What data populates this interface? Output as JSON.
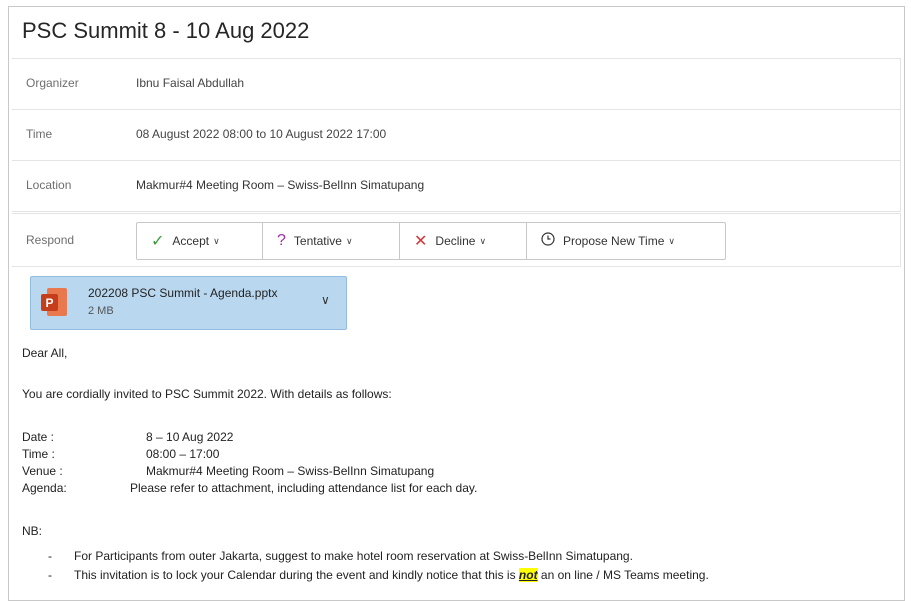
{
  "meeting": {
    "title": "PSC Summit 8 - 10 Aug 2022",
    "organizer_label": "Organizer",
    "organizer": "Ibnu Faisal Abdullah",
    "time_label": "Time",
    "time": "08 August 2022 08:00 to 10 August 2022 17:00",
    "location_label": "Location",
    "location": "Makmur#4 Meeting Room – Swiss-BelInn Simatupang",
    "respond_label": "Respond"
  },
  "respond": {
    "accept": "Accept",
    "tentative": "Tentative",
    "decline": "Decline",
    "propose": "Propose New Time"
  },
  "attachment": {
    "name": "202208 PSC Summit - Agenda.pptx",
    "size": "2 MB"
  },
  "body": {
    "greeting": "Dear All,",
    "intro": "You are cordially invited to PSC Summit 2022. With details as follows:",
    "date_label": "Date :",
    "date": "8 – 10 Aug 2022",
    "time_label": "Time :",
    "time": "08:00 – 17:00",
    "venue_label": "Venue :",
    "venue": "Makmur#4 Meeting Room – Swiss-BelInn Simatupang",
    "agenda_label": "Agenda:",
    "agenda": "Please refer to attachment, including attendance list for each day.",
    "nb_label": "NB:",
    "bullet_dash": "-",
    "nb1": "For Participants from outer Jakarta, suggest to make hotel room reservation at Swiss-BelInn Simatupang.",
    "nb2_pre": "This invitation is to lock your Calendar during the event and kindly notice that this is",
    "nb2_emph": "not",
    "nb2_post": "an on line / MS Teams meeting."
  },
  "icons": {
    "accept": "checkmark-icon",
    "tentative": "question-icon",
    "decline": "x-icon",
    "propose": "clock-icon",
    "attachment": "powerpoint-icon"
  },
  "colors": {
    "accept": "#3a9b3a",
    "tentative": "#9b2fa8",
    "decline": "#d13438",
    "attachment_bg": "#b9d8f0",
    "ppt": "#c43e1c",
    "highlight": "#ffff00"
  }
}
